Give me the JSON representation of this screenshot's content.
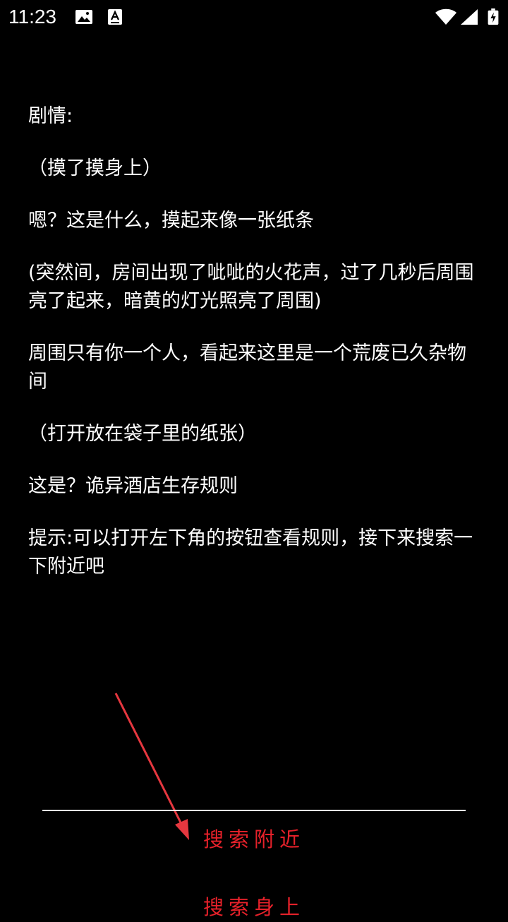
{
  "status_bar": {
    "time": "11:23",
    "icons": [
      "image-notification-icon",
      "font-notification-icon",
      "wifi-icon",
      "cellular-signal-icon",
      "battery-charging-icon"
    ]
  },
  "story": {
    "paragraphs": [
      "剧情:",
      "（摸了摸身上）",
      "嗯？这是什么，摸起来像一张纸条",
      "(突然间，房间出现了呲呲的火花声，过了几秒后周围亮了起来，暗黄的灯光照亮了周围)",
      "周围只有你一个人，看起来这里是一个荒废已久杂物间",
      "（打开放在袋子里的纸张）",
      "这是？诡异酒店生存规则",
      "提示:可以打开左下角的按钮查看规则，接下来搜索一下附近吧"
    ]
  },
  "actions": {
    "search_nearby": "搜索附近",
    "search_self": "搜索身上"
  },
  "colors": {
    "background": "#000000",
    "text": "#ffffff",
    "accent": "#e6212a"
  }
}
